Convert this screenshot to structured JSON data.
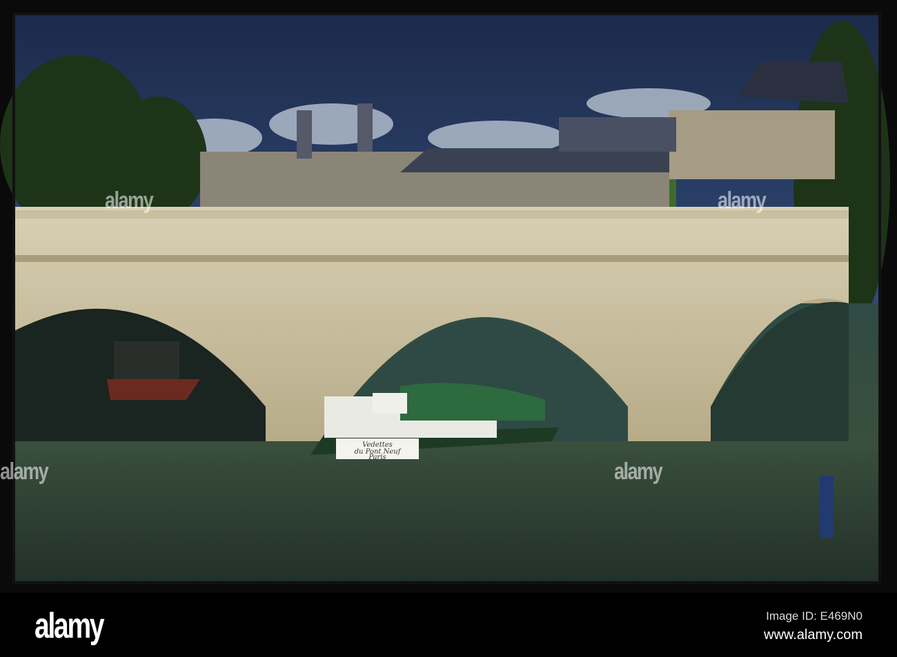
{
  "watermark": {
    "text": "alamy"
  },
  "boat_sign": {
    "line1": "Vedettes",
    "line2": "du Pont Neuf",
    "line3": "Paris"
  },
  "footer": {
    "logo": "alamy",
    "image_id": "Image ID: E469N0",
    "website": "www.alamy.com"
  }
}
